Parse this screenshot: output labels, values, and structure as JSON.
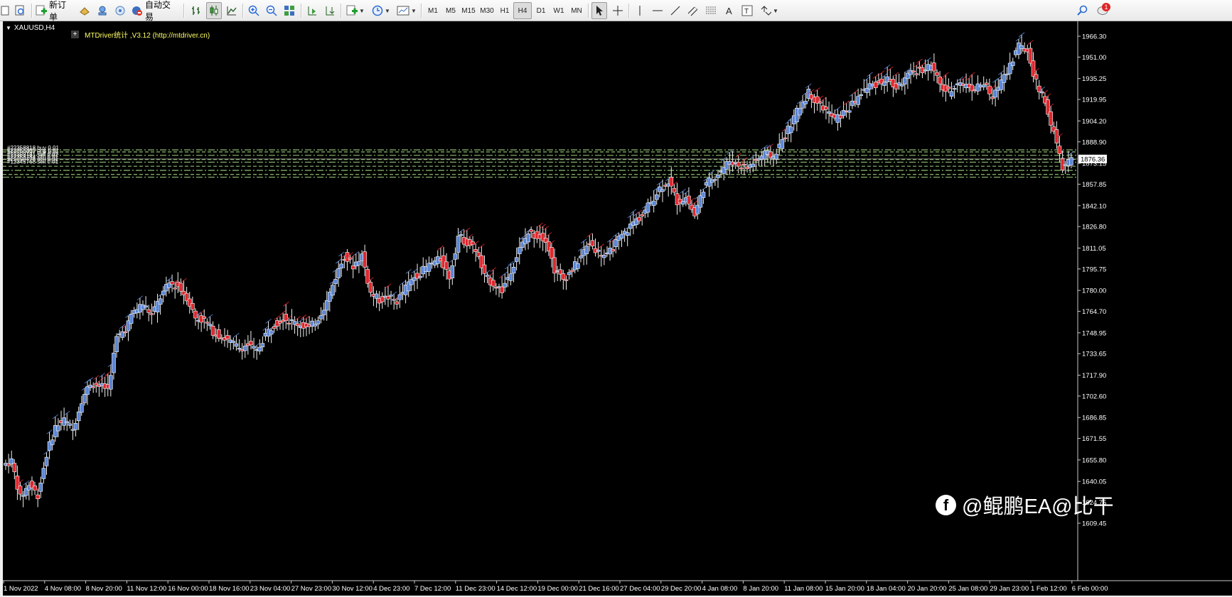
{
  "toolbar": {
    "new_order_label": "新订单",
    "auto_trade_label": "自动交易",
    "timeframes": [
      "M1",
      "M5",
      "M15",
      "M30",
      "H1",
      "H4",
      "D1",
      "W1",
      "MN"
    ],
    "active_timeframe": "H4",
    "notification_count": "1"
  },
  "chart": {
    "symbol": "XAUUSD,H4",
    "indicator_label": "MTDriver统计 ,V3.12 (http://mtdriver.cn)",
    "current_price": "1876.36",
    "current_price_bg": "#ffffff",
    "order_line_color": "#8fbc6f",
    "bull_color": "#5b86d6",
    "bear_color": "#e0262d",
    "price_levels": [
      "1966.30",
      "1951.00",
      "1935.25",
      "1919.95",
      "1904.20",
      "1888.90",
      "1873.15",
      "1857.85",
      "1842.10",
      "1826.80",
      "1811.05",
      "1795.75",
      "1780.00",
      "1764.70",
      "1748.95",
      "1733.65",
      "1717.90",
      "1702.60",
      "1686.85",
      "1671.55",
      "1655.80",
      "1640.05",
      "1624.75",
      "1609.45"
    ],
    "time_labels": [
      "1 Nov 2022",
      "4 Nov 08:00",
      "8 Nov 20:00",
      "11 Nov 12:00",
      "16 Nov 00:00",
      "18 Nov 16:00",
      "23 Nov 04:00",
      "27 Nov 23:00",
      "30 Nov 12:00",
      "4 Dec 23:00",
      "7 Dec 12:00",
      "11 Dec 23:00",
      "14 Dec 12:00",
      "19 Dec 00:00",
      "21 Dec 16:00",
      "27 Dec 04:00",
      "29 Dec 20:00",
      "4 Jan 08:00",
      "8 Jan 20:00",
      "11 Jan 08:00",
      "15 Jan 20:00",
      "18 Jan 04:00",
      "20 Jan 20:00",
      "25 Jan 08:00",
      "29 Jan 23:00",
      "1 Feb 12:00",
      "6 Feb 00:00"
    ],
    "order_labels": [
      "#22358818 buy 0.01",
      "#22358809 buy 0.01",
      "#22358797 buy 0.01",
      "#22358791 sell 0.01",
      "#22358784 sell 0.01",
      "#22358776 sell 0.01",
      "#12345768 sell 0.01"
    ],
    "price_series": [
      1652,
      1655,
      1628,
      1638,
      1630,
      1660,
      1680,
      1685,
      1678,
      1700,
      1712,
      1710,
      1708,
      1745,
      1752,
      1765,
      1770,
      1762,
      1775,
      1785,
      1783,
      1775,
      1760,
      1758,
      1750,
      1746,
      1742,
      1738,
      1740,
      1735,
      1748,
      1755,
      1760,
      1757,
      1755,
      1752,
      1760,
      1772,
      1790,
      1805,
      1798,
      1806,
      1778,
      1773,
      1775,
      1772,
      1782,
      1790,
      1795,
      1800,
      1803,
      1790,
      1820,
      1815,
      1810,
      1790,
      1785,
      1780,
      1795,
      1810,
      1822,
      1820,
      1818,
      1795,
      1788,
      1795,
      1805,
      1815,
      1808,
      1805,
      1815,
      1822,
      1830,
      1835,
      1845,
      1855,
      1860,
      1845,
      1848,
      1835,
      1855,
      1862,
      1868,
      1875,
      1872,
      1870,
      1875,
      1880,
      1878,
      1890,
      1902,
      1915,
      1925,
      1918,
      1912,
      1905,
      1910,
      1916,
      1925,
      1930,
      1932,
      1935,
      1928,
      1935,
      1940,
      1942,
      1945,
      1930,
      1925,
      1933,
      1930,
      1928,
      1932,
      1920,
      1935,
      1945,
      1960,
      1955,
      1932,
      1918,
      1895,
      1870,
      1876
    ]
  },
  "watermark": {
    "icon_letter": "f",
    "text": "@鲲鹏EA@比干"
  }
}
